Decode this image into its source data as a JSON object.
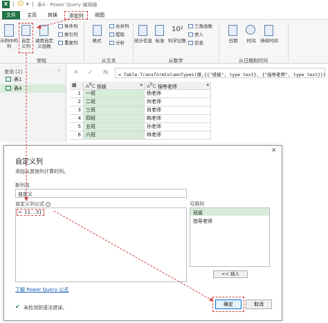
{
  "titlebar": {
    "app_icon": "X",
    "smiley": "☺",
    "window_title": "表4 - Power Query 编辑器"
  },
  "tabs": [
    "文件",
    "主页",
    "转换",
    "添加列",
    "视图"
  ],
  "ribbon": {
    "groups": {
      "general": {
        "label": "常规",
        "example_btn": "示例中的列",
        "custom_btn": "自定义列",
        "invoke_btn": "调用自定义函数",
        "conditional": "条件列",
        "index": "索引列",
        "duplicate": "重复列"
      },
      "text": {
        "label": "从文本",
        "format": "格式",
        "merge": "合并列",
        "extract": "提取",
        "parse": "分析"
      },
      "number": {
        "label": "从数字",
        "stats": "统计信息",
        "standard": "标准",
        "scientific": "科学记数",
        "trig": "三角函数",
        "round": "舍入",
        "info": "信息"
      },
      "datetime": {
        "label": "从日期和时间",
        "date": "日期",
        "time": "时间",
        "duration": "持续时间"
      }
    }
  },
  "queries": {
    "header": "查询 [2]",
    "items": [
      "表1",
      "表4"
    ]
  },
  "formula": {
    "text": "= Table.TransformColumnTypes(源,{{\"班级\", type text}, {\"指导老师\", type text}})"
  },
  "grid": {
    "headers": [
      "班级",
      "指导老师"
    ],
    "rows": [
      [
        "1",
        "一班",
        "杨老师"
      ],
      [
        "2",
        "二班",
        "何老师"
      ],
      [
        "3",
        "三班",
        "肖老师"
      ],
      [
        "4",
        "四班",
        "韩老师"
      ],
      [
        "5",
        "五班",
        "孙老师"
      ],
      [
        "6",
        "六班",
        "林老师"
      ]
    ]
  },
  "dialog": {
    "title": "自定义列",
    "subtitle": "添加从其他列计算的列。",
    "new_col_label": "新列名",
    "new_col_value": "自定义",
    "formula_label": "自定义列公式",
    "formula_value": "= {1..5}",
    "available_label": "可用列",
    "available_cols": [
      "班级",
      "指导老师"
    ],
    "insert_btn": "<< 插入",
    "learn_link": "了解 Power Query 公式",
    "status": "未检测到语法错误。",
    "ok": "确定",
    "cancel": "取消"
  },
  "colors": {
    "excel_green": "#217346",
    "highlight_red": "#d04040",
    "selection_green": "#d7ecd9"
  }
}
